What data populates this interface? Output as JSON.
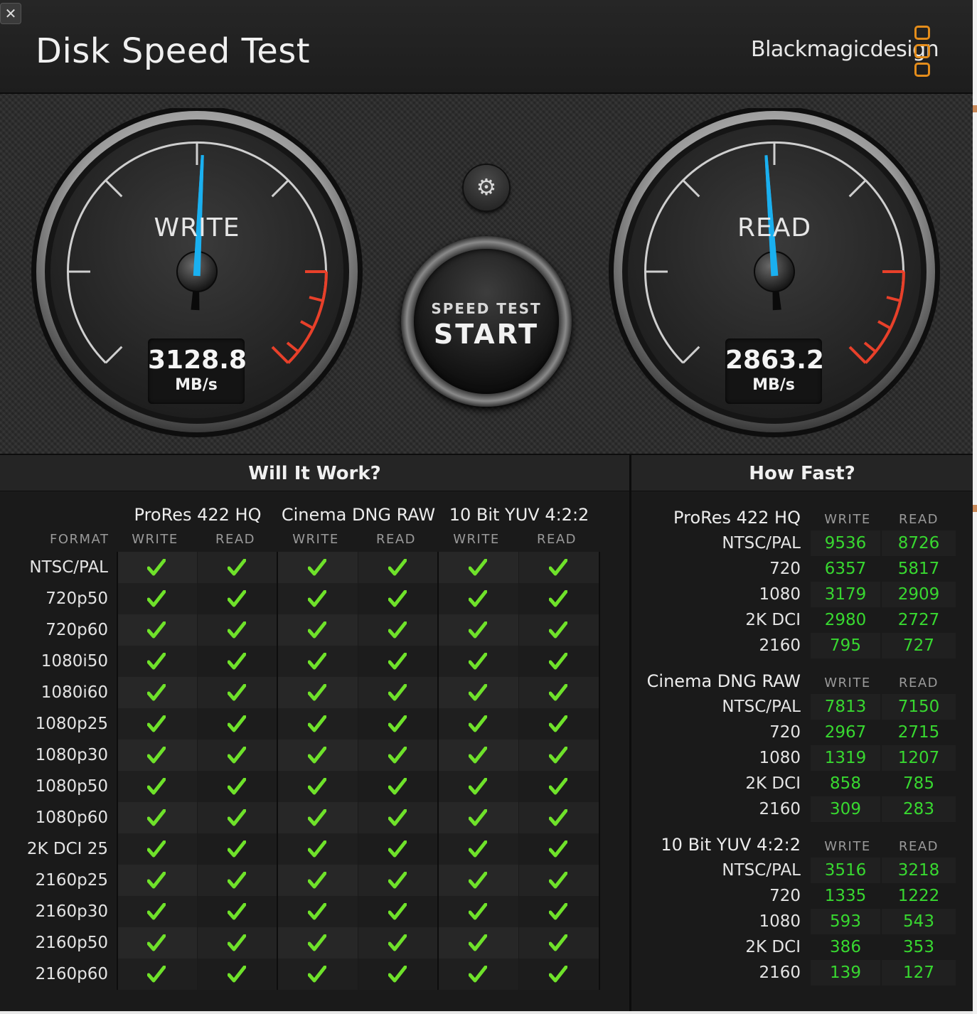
{
  "window": {
    "close_glyph": "✕",
    "title": "Disk Speed Test",
    "brand": "Blackmagicdesign"
  },
  "gauges": {
    "write": {
      "label": "WRITE",
      "value": "3128.8",
      "unit": "MB/s",
      "needle_fraction": 0.51
    },
    "read": {
      "label": "READ",
      "value": "2863.2",
      "unit": "MB/s",
      "needle_fraction": 0.485
    }
  },
  "start_button": {
    "subtitle": "SPEED TEST",
    "label": "START"
  },
  "settings_icon": "gear-icon",
  "will_it_work": {
    "title": "Will It Work?",
    "format_label": "FORMAT",
    "groups": [
      "ProRes 422 HQ",
      "Cinema DNG RAW",
      "10 Bit YUV 4:2:2"
    ],
    "write_label": "WRITE",
    "read_label": "READ",
    "formats": [
      "NTSC/PAL",
      "720p50",
      "720p60",
      "1080i50",
      "1080i60",
      "1080p25",
      "1080p30",
      "1080p50",
      "1080p60",
      "2K DCI 25",
      "2160p25",
      "2160p30",
      "2160p50",
      "2160p60"
    ],
    "check_color": "#6fe22a"
  },
  "how_fast": {
    "title": "How Fast?",
    "write_label": "WRITE",
    "read_label": "READ",
    "sections": [
      {
        "name": "ProRes 422 HQ",
        "rows": [
          {
            "label": "NTSC/PAL",
            "write": "9536",
            "read": "8726"
          },
          {
            "label": "720",
            "write": "6357",
            "read": "5817"
          },
          {
            "label": "1080",
            "write": "3179",
            "read": "2909"
          },
          {
            "label": "2K DCI",
            "write": "2980",
            "read": "2727"
          },
          {
            "label": "2160",
            "write": "795",
            "read": "727"
          }
        ]
      },
      {
        "name": "Cinema DNG RAW",
        "rows": [
          {
            "label": "NTSC/PAL",
            "write": "7813",
            "read": "7150"
          },
          {
            "label": "720",
            "write": "2967",
            "read": "2715"
          },
          {
            "label": "1080",
            "write": "1319",
            "read": "1207"
          },
          {
            "label": "2K DCI",
            "write": "858",
            "read": "785"
          },
          {
            "label": "2160",
            "write": "309",
            "read": "283"
          }
        ]
      },
      {
        "name": "10 Bit YUV 4:2:2",
        "rows": [
          {
            "label": "NTSC/PAL",
            "write": "3516",
            "read": "3218"
          },
          {
            "label": "720",
            "write": "1335",
            "read": "1222"
          },
          {
            "label": "1080",
            "write": "593",
            "read": "543"
          },
          {
            "label": "2K DCI",
            "write": "386",
            "read": "353"
          },
          {
            "label": "2160",
            "write": "139",
            "read": "127"
          }
        ]
      }
    ]
  },
  "colors": {
    "needle": "#1ab0f0",
    "redline": "#e8402a",
    "value_green": "#38d830",
    "brand_orange": "#e48d1b"
  }
}
